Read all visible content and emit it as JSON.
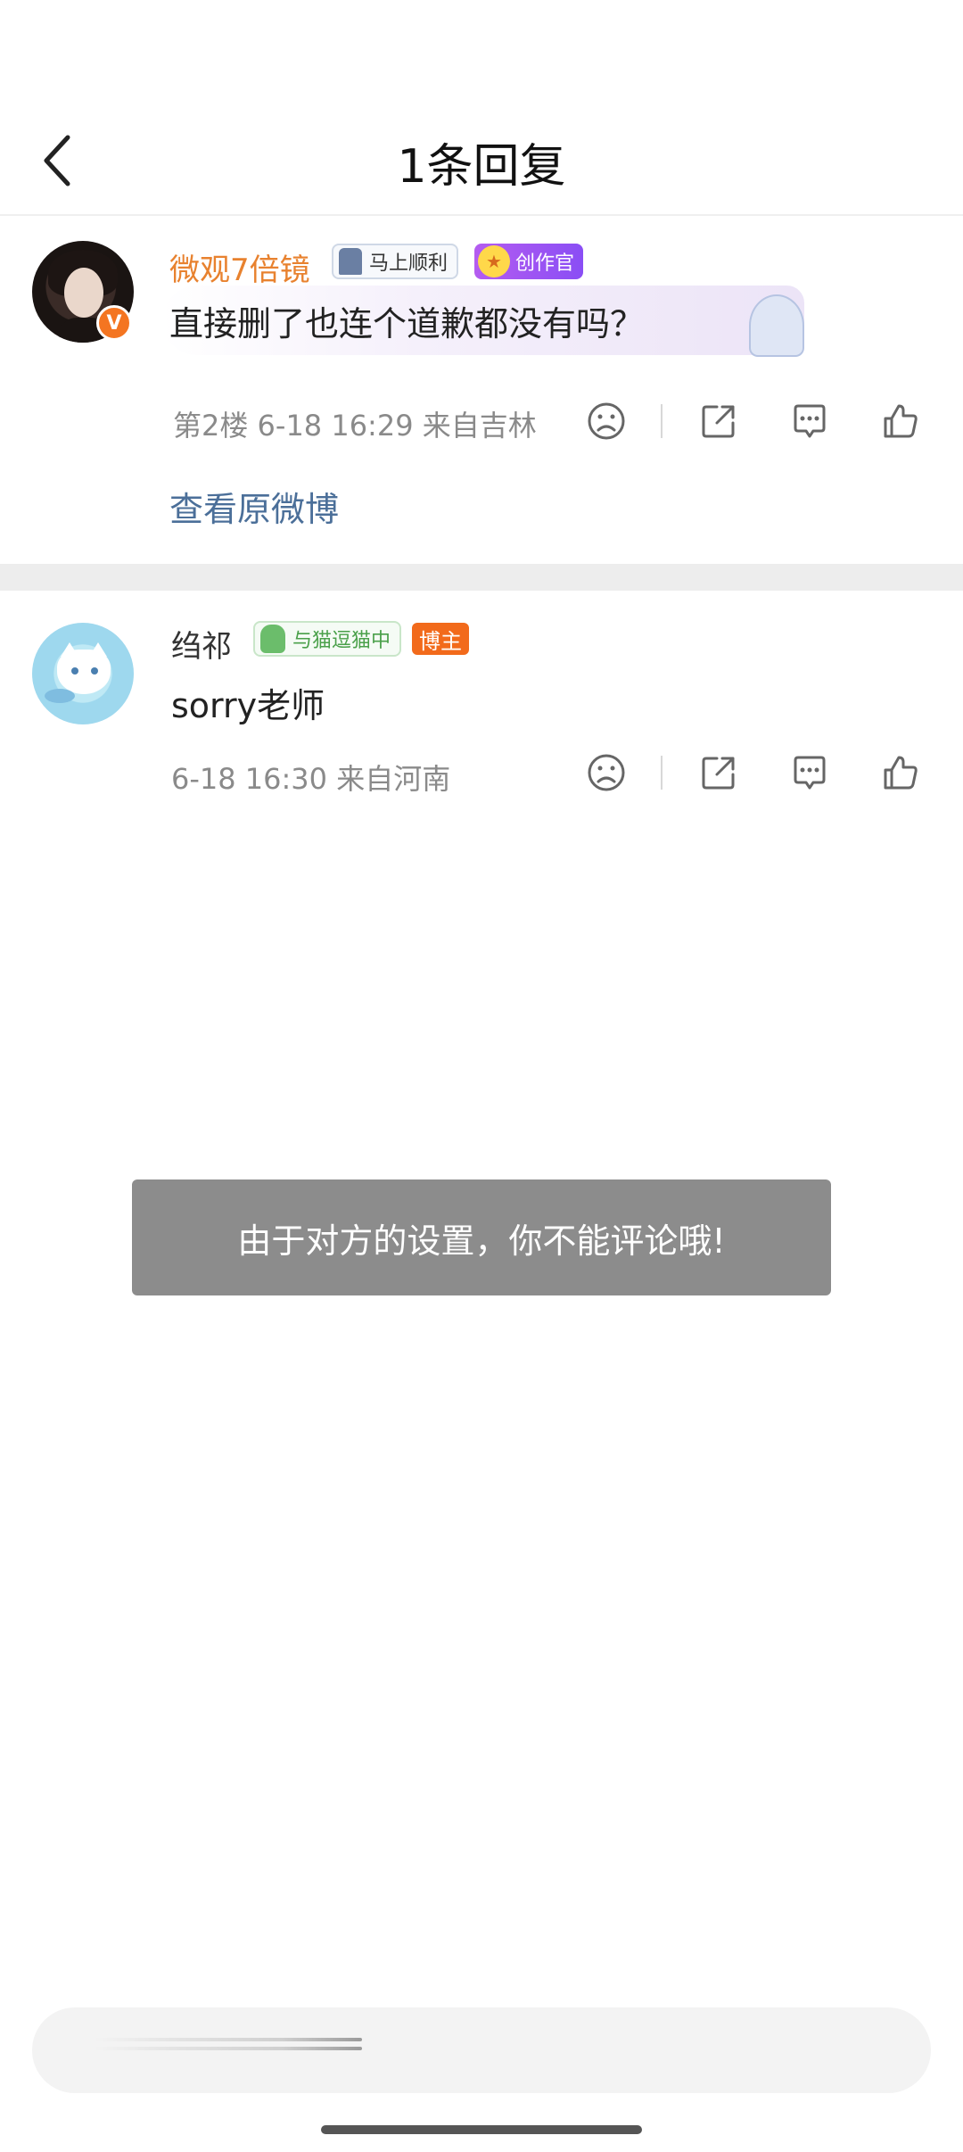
{
  "header": {
    "title": "1条回复",
    "back_icon": "chevron-left-icon"
  },
  "comments": [
    {
      "username": "微观7倍镜",
      "verified": "V",
      "tags": [
        "马上顺利",
        "创作官"
      ],
      "text": "直接删了也连个道歉都没有吗？",
      "meta": "第2楼 6-18 16:29 来自吉林",
      "view_original": "查看原微博"
    },
    {
      "username": "绉祁",
      "tags": [
        "与猫逗猫中",
        "博主"
      ],
      "text": "sorry老师",
      "meta": "6-18 16:30 来自河南"
    }
  ],
  "toast": {
    "text": "由于对方的设置，你不能评论哦!"
  },
  "colors": {
    "username_highlight": "#e8822f",
    "link": "#4b6f99",
    "toast_bg": "#8c8c8c",
    "blogger_tag": "#f26a1b",
    "creator_tag": "#8a4ef5"
  }
}
